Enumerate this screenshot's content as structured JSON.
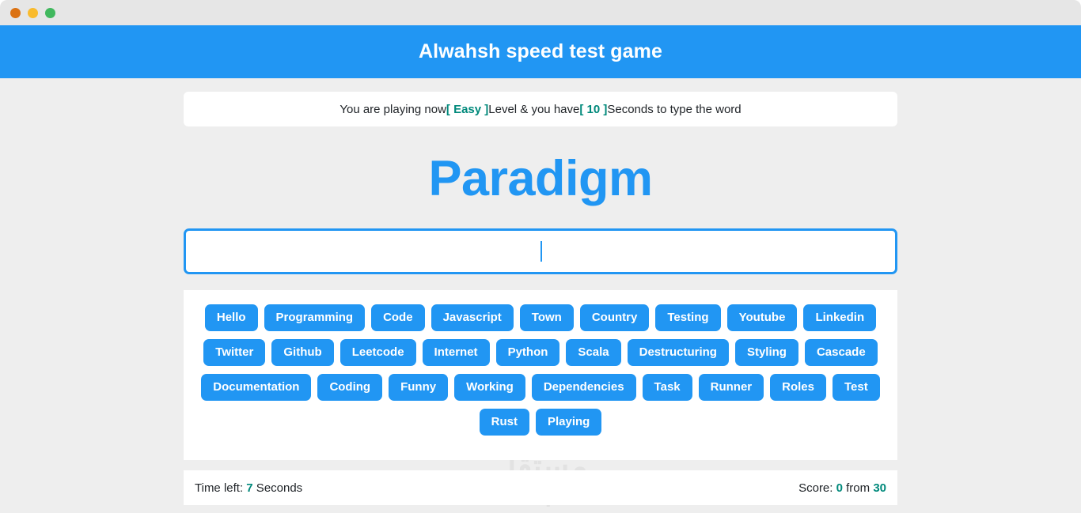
{
  "browser": {
    "dots": [
      "close-red",
      "minimize-yellow",
      "maximize-green"
    ]
  },
  "header": {
    "title": "Alwahsh speed test game",
    "background": "#2196f3"
  },
  "message": {
    "prefix": "You are playing now ",
    "level_label": "[ Easy ]",
    "middle": " Level & you have ",
    "seconds_label": "[ 10 ]",
    "suffix": " Seconds to type the word",
    "highlight_color": "#00897b"
  },
  "word_display": {
    "current_word": "Paradigm",
    "color": "#2196f3"
  },
  "input": {
    "value": "",
    "placeholder": "",
    "border_color": "#2196f3",
    "caret_visible": true
  },
  "words_panel": {
    "chip_color": "#2196f3",
    "chips": [
      "Hello",
      "Programming",
      "Code",
      "Javascript",
      "Town",
      "Country",
      "Testing",
      "Youtube",
      "Linkedin",
      "Twitter",
      "Github",
      "Leetcode",
      "Internet",
      "Python",
      "Scala",
      "Destructuring",
      "Styling",
      "Cascade",
      "Documentation",
      "Coding",
      "Funny",
      "Working",
      "Dependencies",
      "Task",
      "Runner",
      "Roles",
      "Test",
      "Rust",
      "Playing"
    ]
  },
  "status": {
    "time_label": "Time left: ",
    "time_value": "7",
    "time_unit": " Seconds",
    "score_label": "Score: ",
    "score_value": "0",
    "score_middle": " from ",
    "score_total": "30",
    "highlight_color": "#00897b"
  },
  "watermark": {
    "arabic": "مستقل",
    "domain": "mostaql.com"
  }
}
